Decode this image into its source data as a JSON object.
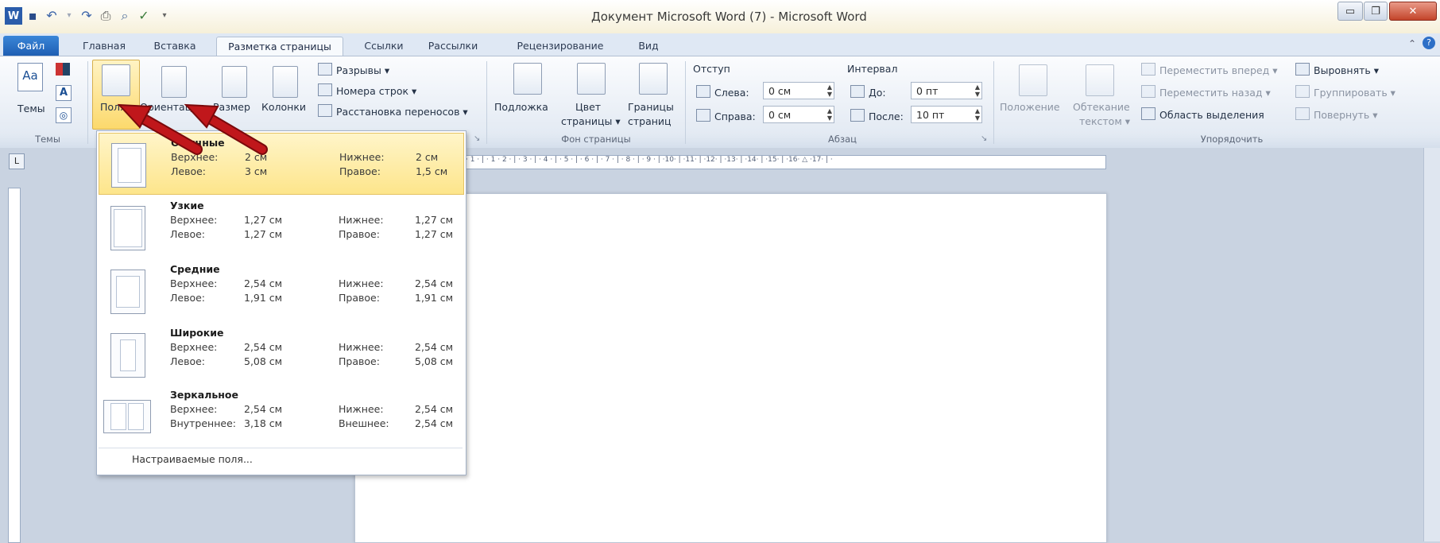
{
  "window": {
    "title": "Документ Microsoft Word (7) - Microsoft Word",
    "buttons": {
      "minimize": "▭",
      "maximize": "❐",
      "close": "✕"
    }
  },
  "quick_access": {
    "icons": [
      "word-app-icon",
      "save-icon",
      "undo-icon",
      "redo-icon",
      "print-icon",
      "print-preview-icon",
      "spelling-icon",
      "qat-dropdown-icon"
    ]
  },
  "tabs": {
    "file": "Файл",
    "items": [
      "Главная",
      "Вставка",
      "Разметка страницы",
      "Ссылки",
      "Рассылки",
      "Рецензирование",
      "Вид"
    ],
    "active_index": 2
  },
  "ribbon": {
    "themes_group": {
      "label": "Темы",
      "themes_button": "Темы"
    },
    "page_setup": {
      "margins": "Поля",
      "orientation": "Ориентация",
      "size": "Размер",
      "columns": "Колонки",
      "breaks": "Разрывы ▾",
      "line_numbers": "Номера строк ▾",
      "hyphenation": "Расстановка переносов ▾"
    },
    "page_background": {
      "label": "Фон страницы",
      "watermark": "Подложка",
      "page_color_1": "Цвет",
      "page_color_2": "страницы ▾",
      "page_borders_1": "Границы",
      "page_borders_2": "страниц"
    },
    "paragraph": {
      "label": "Абзац",
      "indent_title": "Отступ",
      "left_label": "Слева:",
      "left_value": "0 см",
      "right_label": "Справа:",
      "right_value": "0 см",
      "spacing_title": "Интервал",
      "before_label": "До:",
      "before_value": "0 пт",
      "after_label": "После:",
      "after_value": "10 пт"
    },
    "arrange": {
      "label": "Упорядочить",
      "position": "Положение",
      "wrap_1": "Обтекание",
      "wrap_2": "текстом ▾",
      "bring_forward": "Переместить вперед ▾",
      "send_backward": "Переместить назад ▾",
      "selection_pane": "Область выделения",
      "align": "Выровнять ▾",
      "group": "Группировать ▾",
      "rotate": "Повернуть ▾"
    }
  },
  "ruler": {
    "toggle": "L",
    "ticks": "· 1 · | · 1 · 2 · | · 3 · | · 4 · | · 5 · | · 6 · | · 7 · | · 8 · | · 9 · | ·10· | ·11· | ·12· | ·13· | ·14· | ·15· | ·16· △ ·17· | ·"
  },
  "margins_menu": {
    "options": [
      {
        "name": "Обычные",
        "top_label": "Верхнее:",
        "top": "2 см",
        "left_label": "Левое:",
        "left": "3 см",
        "bottom_label": "Нижнее:",
        "bottom": "2 см",
        "right_label": "Правое:",
        "right": "1,5 см"
      },
      {
        "name": "Узкие",
        "top_label": "Верхнее:",
        "top": "1,27 см",
        "left_label": "Левое:",
        "left": "1,27 см",
        "bottom_label": "Нижнее:",
        "bottom": "1,27 см",
        "right_label": "Правое:",
        "right": "1,27 см"
      },
      {
        "name": "Средние",
        "top_label": "Верхнее:",
        "top": "2,54 см",
        "left_label": "Левое:",
        "left": "1,91 см",
        "bottom_label": "Нижнее:",
        "bottom": "2,54 см",
        "right_label": "Правое:",
        "right": "1,91 см"
      },
      {
        "name": "Широкие",
        "top_label": "Верхнее:",
        "top": "2,54 см",
        "left_label": "Левое:",
        "left": "5,08 см",
        "bottom_label": "Нижнее:",
        "bottom": "2,54 см",
        "right_label": "Правое:",
        "right": "5,08 см"
      },
      {
        "name": "Зеркальное",
        "top_label": "Верхнее:",
        "top": "2,54 см",
        "left_label": "Внутреннее:",
        "left": "3,18 см",
        "bottom_label": "Нижнее:",
        "bottom": "2,54 см",
        "right_label": "Внешнее:",
        "right": "2,54 см"
      }
    ],
    "selected_index": 0,
    "custom": "Настраиваемые поля..."
  },
  "annotations": {
    "arrow_color": "#c0171b",
    "arrow_outline": "#7a0a0c"
  }
}
